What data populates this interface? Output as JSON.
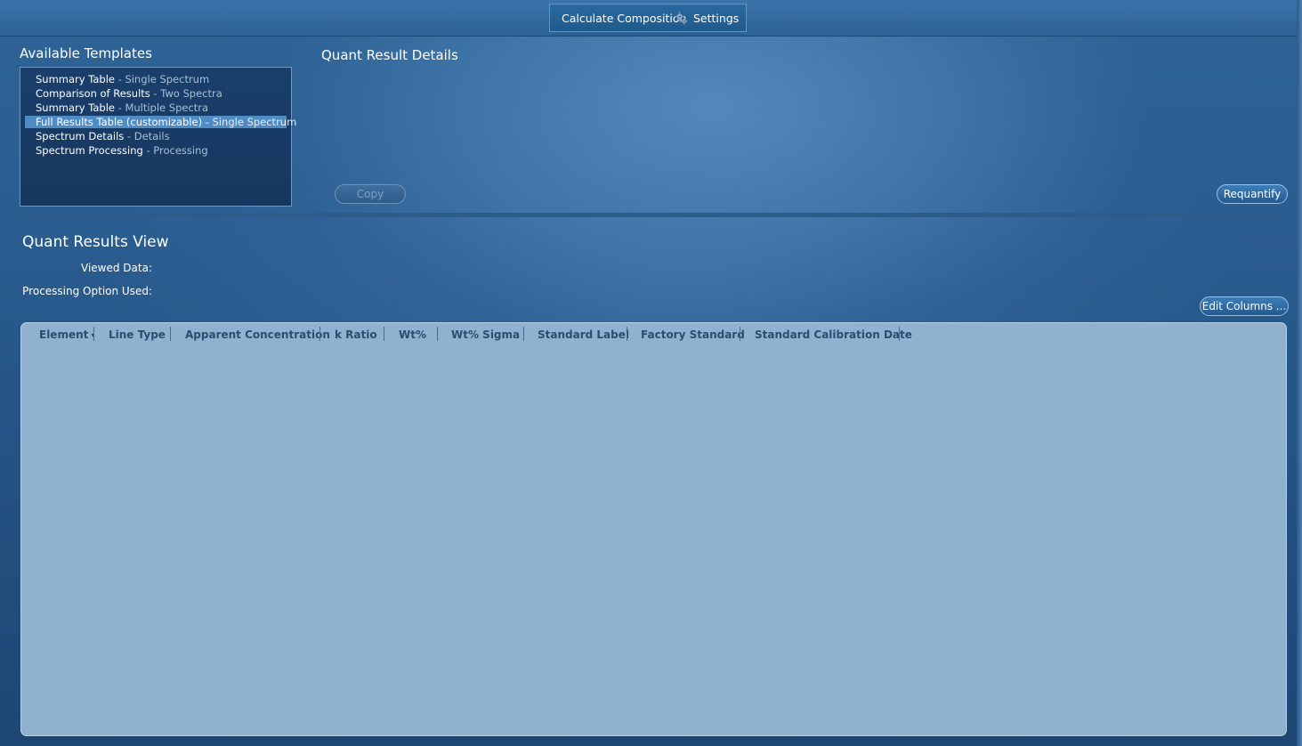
{
  "toolbar": {
    "calculate_label": "Calculate Composition",
    "settings_label": "Settings",
    "settings_icon": "gear-icon"
  },
  "templates": {
    "heading": "Available Templates",
    "items": [
      {
        "name": "Summary Table",
        "desc": "Single Spectrum",
        "selected": false
      },
      {
        "name": "Comparison of Results",
        "desc": "Two Spectra",
        "selected": false
      },
      {
        "name": "Summary Table",
        "desc": "Multiple Spectra",
        "selected": false
      },
      {
        "name": "Full Results Table (customizable)",
        "desc": "Single Spectrum",
        "selected": true
      },
      {
        "name": "Spectrum Details",
        "desc": "Details",
        "selected": false
      },
      {
        "name": "Spectrum Processing",
        "desc": "Processing",
        "selected": false
      }
    ]
  },
  "details": {
    "heading": "Quant Result Details",
    "copy_label": "Copy",
    "requantify_label": "Requantify"
  },
  "results": {
    "heading": "Quant Results View",
    "viewed_data_label": "Viewed Data:",
    "processing_option_label": "Processing Option Used:",
    "edit_columns_label": "Edit Columns ...",
    "columns": [
      "Element",
      "Line Type",
      "Apparent Concentration",
      "k Ratio",
      "Wt%",
      "Wt% Sigma",
      "Standard Label",
      "Factory Standard",
      "Standard Calibration Date"
    ],
    "sort_indicator": "▾"
  }
}
